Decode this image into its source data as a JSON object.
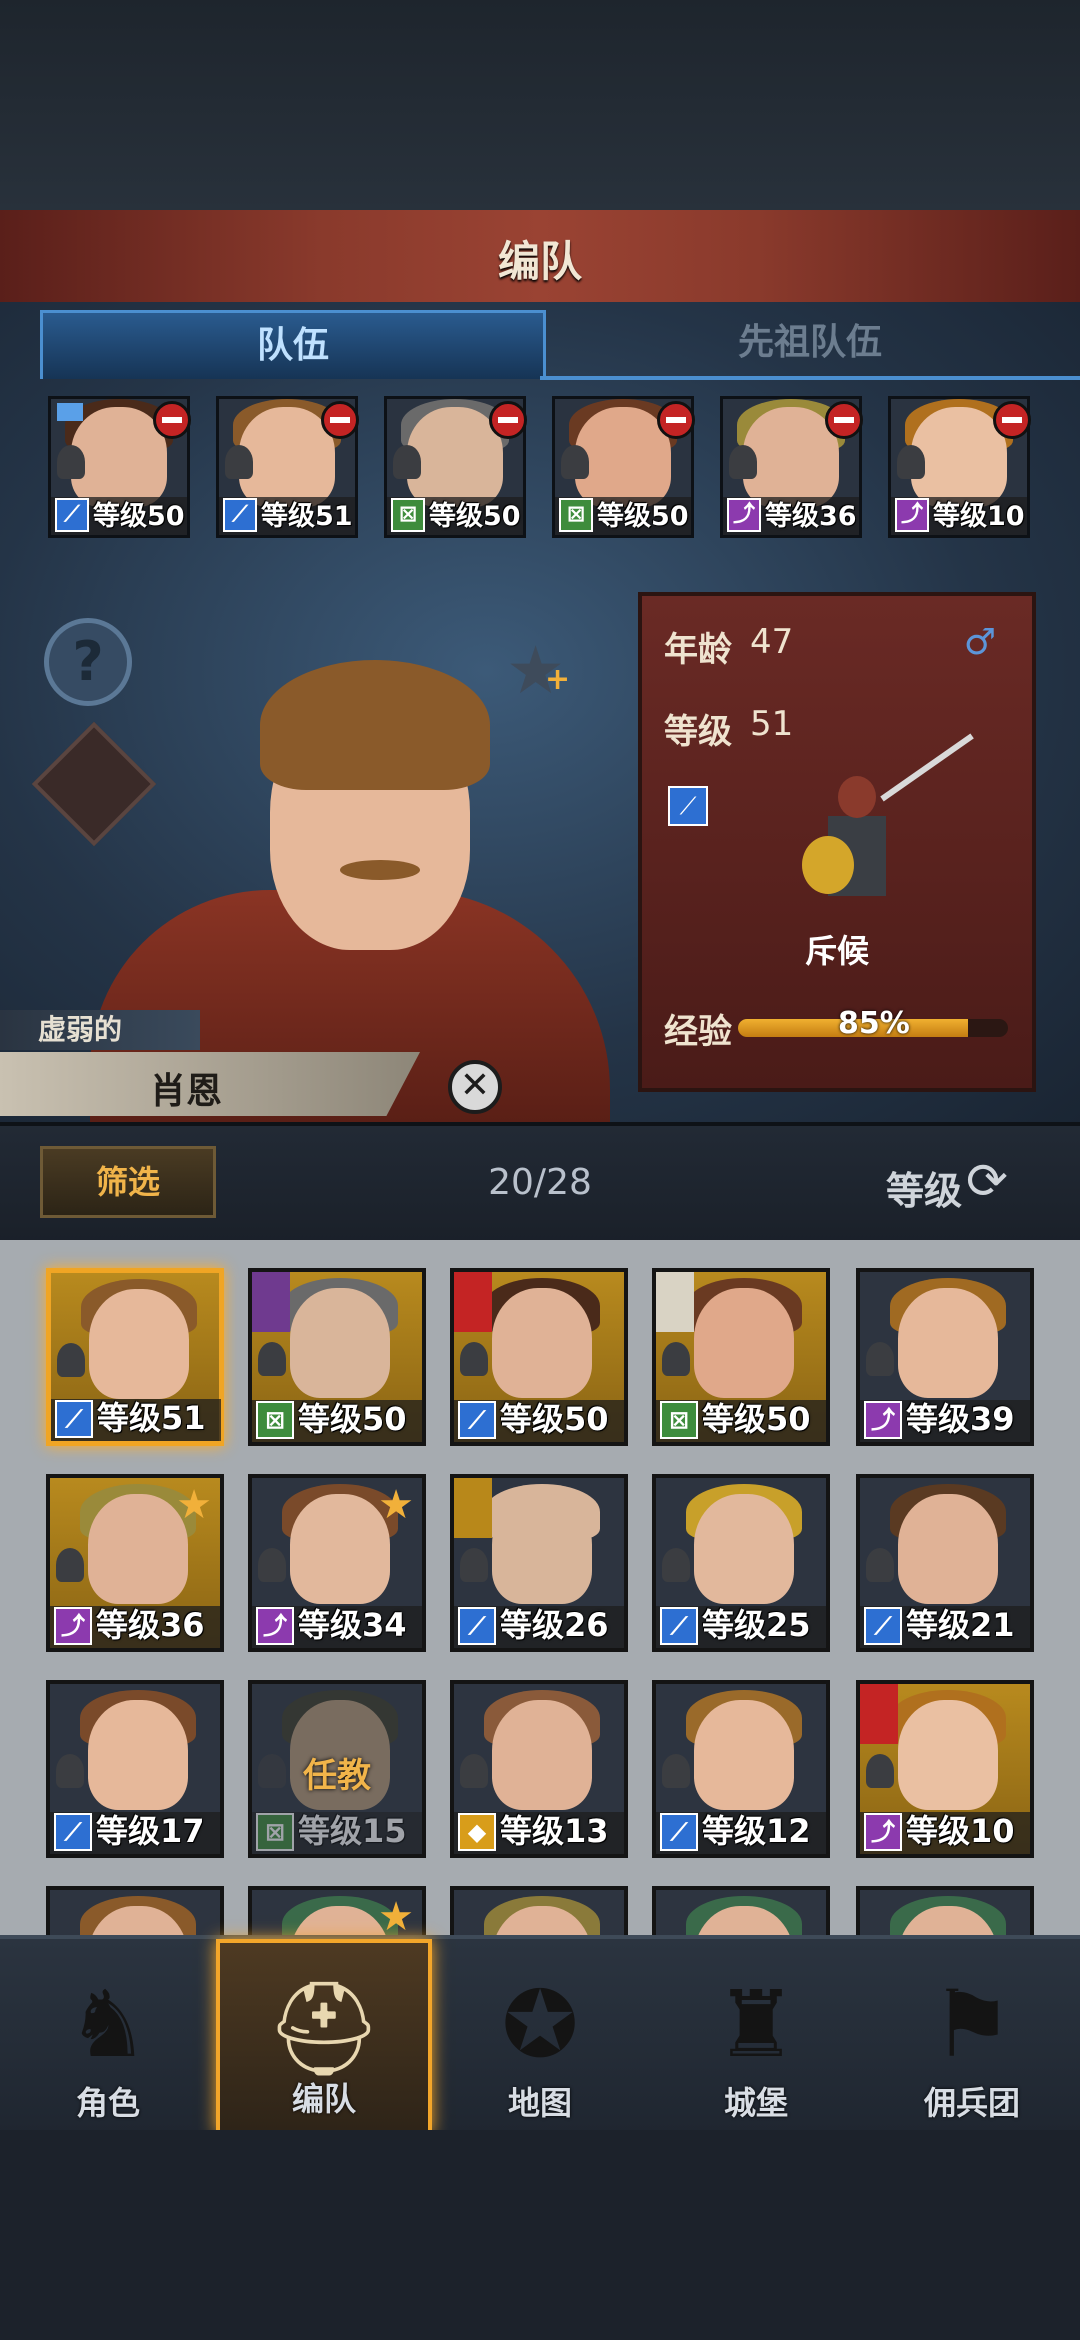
{
  "header": {
    "title": "编队"
  },
  "tabs": [
    {
      "label": "队伍",
      "active": true
    },
    {
      "label": "先祖队伍",
      "active": false
    }
  ],
  "team": [
    {
      "level": "等级50",
      "class": "blue",
      "hair": "#4a2a1a",
      "skin": "#e0b296",
      "flag": true
    },
    {
      "level": "等级51",
      "class": "blue",
      "hair": "#8a5a2a",
      "skin": "#e6b89a"
    },
    {
      "level": "等级50",
      "class": "green",
      "hair": "#6a6a6a",
      "skin": "#d9b59a"
    },
    {
      "level": "等级50",
      "class": "green",
      "hair": "#6a3a22",
      "skin": "#e0a88a"
    },
    {
      "level": "等级36",
      "class": "purple",
      "hair": "#9a8a3a",
      "skin": "#e0b296"
    },
    {
      "level": "等级10",
      "class": "purple",
      "hair": "#b0701e",
      "skin": "#eac0a2"
    }
  ],
  "hero": {
    "age_label": "年龄",
    "age": "47",
    "level_label": "等级",
    "level": "51",
    "class_name": "斥候",
    "exp_label": "经验",
    "exp": "85%",
    "exp_value": 0.85,
    "trait": "虚弱的",
    "name": "肖恩",
    "gender_icon": "male-icon"
  },
  "filter": {
    "label": "筛选",
    "count": "20/28",
    "sort_label": "等级"
  },
  "roster": [
    {
      "level": "等级51",
      "class": "blue",
      "bg": "gold",
      "sel": true,
      "hair": "#8a5a2a",
      "skin": "#e6b89a"
    },
    {
      "level": "等级50",
      "class": "green",
      "bg": "gold",
      "banner": "purple",
      "hair": "#6a6a6a",
      "skin": "#d9b59a"
    },
    {
      "level": "等级50",
      "class": "blue",
      "bg": "gold",
      "banner": "red",
      "hair": "#4a2a1a",
      "skin": "#e0b296"
    },
    {
      "level": "等级50",
      "class": "green",
      "bg": "gold",
      "banner": "white",
      "hair": "#6a3a22",
      "skin": "#e0a88a"
    },
    {
      "level": "等级39",
      "class": "purple",
      "bg": "dark",
      "hair": "#a06a22",
      "skin": "#e6b89a"
    },
    {
      "level": "等级36",
      "class": "purple",
      "bg": "gold",
      "star": true,
      "hair": "#9a8a3a",
      "skin": "#e0b296"
    },
    {
      "level": "等级34",
      "class": "purple",
      "bg": "dark",
      "star": true,
      "hair": "#7a4a2a",
      "skin": "#e2b89c"
    },
    {
      "level": "等级26",
      "class": "blue",
      "bg": "dark",
      "banner": "gold",
      "hair": "#d8b59a",
      "skin": "#d8b59a"
    },
    {
      "level": "等级25",
      "class": "blue",
      "bg": "dark",
      "hair": "#c8a02a",
      "skin": "#e2b89c"
    },
    {
      "level": "等级21",
      "class": "blue",
      "bg": "dark",
      "hair": "#5a3a22",
      "skin": "#e0b296"
    },
    {
      "level": "等级17",
      "class": "blue",
      "bg": "dark",
      "hair": "#7a4a2a",
      "skin": "#e6b89a"
    },
    {
      "level": "等级15",
      "class": "green",
      "bg": "dark",
      "dim": true,
      "assign": "任教",
      "hair": "#3a3a2a",
      "skin": "#b89a7a"
    },
    {
      "level": "等级13",
      "class": "yellow",
      "bg": "dark",
      "hair": "#8a5a3a",
      "skin": "#e0b296"
    },
    {
      "level": "等级12",
      "class": "blue",
      "bg": "dark",
      "hair": "#9a6a2a",
      "skin": "#e6b89a"
    },
    {
      "level": "等级10",
      "class": "purple",
      "bg": "gold",
      "banner": "red",
      "hair": "#b0701e",
      "skin": "#eac0a2"
    },
    {
      "level": "",
      "class": "",
      "bg": "dark",
      "partial": true,
      "hair": "#8a5a2a",
      "skin": "#e0b296"
    },
    {
      "level": "",
      "class": "",
      "bg": "dark",
      "partial": true,
      "star": true,
      "hair": "#3a6a4a",
      "skin": "#e0b296"
    },
    {
      "level": "",
      "class": "",
      "bg": "dark",
      "partial": true,
      "hair": "#8a7a3a",
      "skin": "#e0b296"
    },
    {
      "level": "",
      "class": "",
      "bg": "dark",
      "partial": true,
      "hair": "#3a6a4a",
      "skin": "#e0b296"
    },
    {
      "level": "",
      "class": "",
      "bg": "dark",
      "partial": true,
      "hair": "#3a6a4a",
      "skin": "#e0b296"
    }
  ],
  "nav": [
    {
      "label": "角色",
      "icon": "knight-icon",
      "glyph": "♞",
      "active": false
    },
    {
      "label": "编队",
      "icon": "helmet-icon",
      "glyph": "⛑",
      "active": true
    },
    {
      "label": "地图",
      "icon": "compass-icon",
      "glyph": "✪",
      "active": false
    },
    {
      "label": "城堡",
      "icon": "castle-icon",
      "glyph": "♜",
      "active": false
    },
    {
      "label": "佣兵团",
      "icon": "banner-icon",
      "glyph": "⚑",
      "active": false
    }
  ]
}
